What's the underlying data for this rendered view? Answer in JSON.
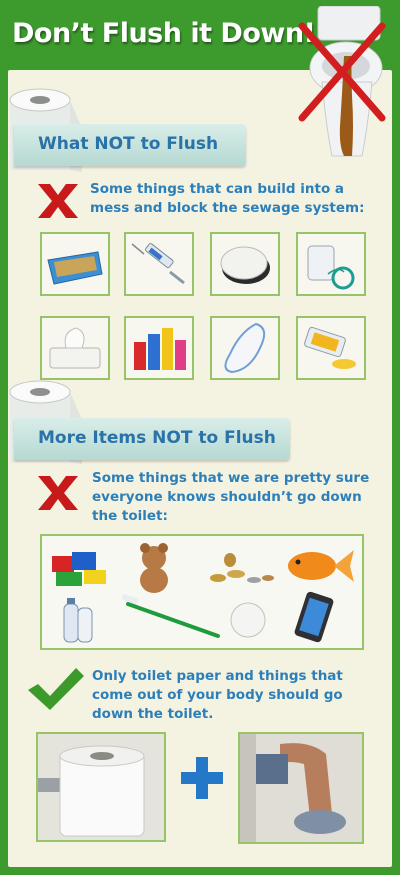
{
  "title": "Don’t Flush it Down!",
  "section1": {
    "heading": "What NOT to Flush",
    "text": "Some things that can build into a mess and block the sewage system:",
    "items": [
      "cat-litter-icon",
      "syringe-icon",
      "cotton-pad-icon",
      "dental-floss-icon",
      "wet-wipes-icon",
      "chemicals-icon",
      "sanitary-pad-icon",
      "cooking-oil-icon"
    ]
  },
  "section2": {
    "heading": "More Items NOT to Flush",
    "text": "Some things that we are pretty sure everyone knows shouldn’t go down the toilet:",
    "items": [
      "lego-bricks-icon",
      "teddy-bear-icon",
      "coins-icon",
      "goldfish-icon",
      "bottles-icon",
      "toothbrush-icon",
      "golf-ball-icon",
      "phone-icon"
    ]
  },
  "section3": {
    "text": "Only toilet paper and things that come out of your body should go down the toilet.",
    "items": [
      "toilet-paper-icon",
      "plus-icon",
      "person-on-toilet-icon"
    ]
  },
  "colors": {
    "frame": "#3d9b2e",
    "panel": "#f4f3e2",
    "heading": "#2a73a8",
    "text": "#2d7fb9",
    "cross": "#c81a1a",
    "check": "#3c9a2b"
  }
}
